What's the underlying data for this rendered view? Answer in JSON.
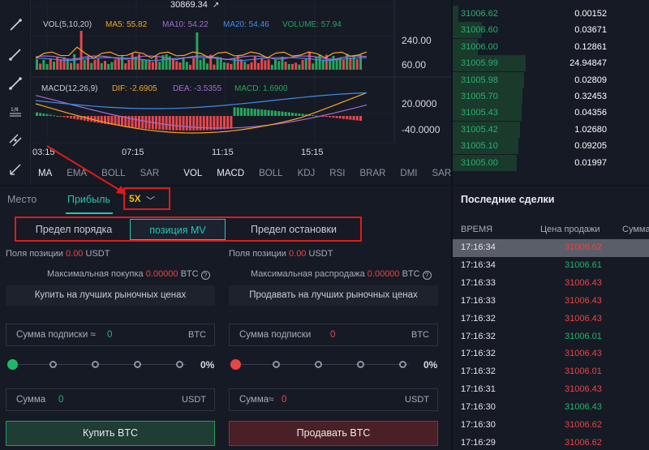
{
  "chart": {
    "price_label": "30869.34",
    "vol_legend": {
      "name": "VOL(5,10,20)",
      "ma5": "MA5: 55.82",
      "ma10": "MA10: 54.22",
      "ma20": "MA20: 54.46",
      "volume": "VOLUME: 57.94"
    },
    "vol_axis": [
      "240.00",
      "60.00"
    ],
    "macd_legend": {
      "name": "MACD(12,26,9)",
      "dif": "DIF: -2.6905",
      "dea": "DEA: -3.5355",
      "macd": "MACD: 1.6900"
    },
    "macd_axis": [
      "20.0000",
      "-40.0000"
    ],
    "time_labels": [
      "03:15",
      "07:15",
      "11:15",
      "15:15"
    ],
    "indicators_main": [
      "MA",
      "EMA",
      "BOLL",
      "SAR"
    ],
    "indicators_sub": [
      "VOL",
      "MACD",
      "BOLL",
      "KDJ",
      "RSI",
      "BRAR",
      "DMI",
      "SAR"
    ],
    "colors": {
      "up": "#26a65b",
      "down": "#e5474d",
      "ma5": "#f5a623",
      "ma10": "#a36bd4",
      "ma20": "#3e8ee8"
    }
  },
  "tools": [
    "pen-icon",
    "line-icon",
    "ray-icon",
    "segment-icon",
    "fib-icon",
    "parallel-icon",
    "measure-icon"
  ],
  "orderbook": {
    "rows": [
      {
        "price": "31006.62",
        "amount": "0.00152",
        "depth": 0.08
      },
      {
        "price": "31006.60",
        "amount": "0.03671",
        "depth": 0.4
      },
      {
        "price": "31006.00",
        "amount": "0.12861",
        "depth": 0.35
      },
      {
        "price": "31005.99",
        "amount": "24.94847",
        "depth": 1.0
      },
      {
        "price": "31005.98",
        "amount": "0.02809",
        "depth": 0.98
      },
      {
        "price": "31005.70",
        "amount": "0.32453",
        "depth": 0.96
      },
      {
        "price": "31005.43",
        "amount": "0.04356",
        "depth": 0.94
      },
      {
        "price": "31005.42",
        "amount": "1.02680",
        "depth": 0.92
      },
      {
        "price": "31005.10",
        "amount": "0.09205",
        "depth": 0.9
      },
      {
        "price": "31005.00",
        "amount": "0.01997",
        "depth": 0.88
      }
    ]
  },
  "trade": {
    "tabs": [
      "Место",
      "Прибыль"
    ],
    "leverage": "5X",
    "order_types": [
      "Предел порядка",
      "позиция MV",
      "Предел остановки"
    ],
    "buy": {
      "position_label": "Поля позиции",
      "position_value": "0.00",
      "position_unit": "USDT",
      "max_label": "Максимальная покупка",
      "max_value": "0.00000",
      "max_unit": "BTC",
      "best_btn": "Купить на лучших рыночных ценах",
      "sub_label": "Сумма подписки ≈",
      "sub_value": "0",
      "sub_unit": "BTC",
      "pct": "0%",
      "sum_label": "Сумма",
      "sum_value": "0",
      "sum_unit": "USDT",
      "action": "Купить BTC"
    },
    "sell": {
      "position_label": "Поля позиции",
      "position_value": "0.00",
      "position_unit": "USDT",
      "max_label": "Максимальная распродажа",
      "max_value": "0.00000",
      "max_unit": "BTC",
      "best_btn": "Продавать на лучших рыночных ценах",
      "sub_label": "Сумма подписки",
      "sub_value": "0",
      "sub_unit": "BTC",
      "pct": "0%",
      "sum_label": "Сумма≈",
      "sum_value": "0",
      "sum_unit": "USDT",
      "action": "Продавать BTC"
    }
  },
  "trades": {
    "title": "Последние сделки",
    "headers": [
      "ВРЕМЯ",
      "Цена продажи",
      "Сумма"
    ],
    "rows": [
      {
        "time": "17:16:34",
        "price": "31006.62",
        "side": "sell",
        "highlight": true
      },
      {
        "time": "17:16:34",
        "price": "31006.61",
        "side": "buy"
      },
      {
        "time": "17:16:33",
        "price": "31006.43",
        "side": "sell"
      },
      {
        "time": "17:16:33",
        "price": "31006.43",
        "side": "sell"
      },
      {
        "time": "17:16:32",
        "price": "31006.43",
        "side": "sell"
      },
      {
        "time": "17:16:32",
        "price": "31006.01",
        "side": "buy"
      },
      {
        "time": "17:16:32",
        "price": "31006.43",
        "side": "sell"
      },
      {
        "time": "17:16:32",
        "price": "31006.01",
        "side": "sell"
      },
      {
        "time": "17:16:31",
        "price": "31006.43",
        "side": "sell"
      },
      {
        "time": "17:16:30",
        "price": "31006.43",
        "side": "buy"
      },
      {
        "time": "17:16:30",
        "price": "31006.62",
        "side": "sell"
      },
      {
        "time": "17:16:29",
        "price": "31006.62",
        "side": "sell"
      }
    ]
  }
}
